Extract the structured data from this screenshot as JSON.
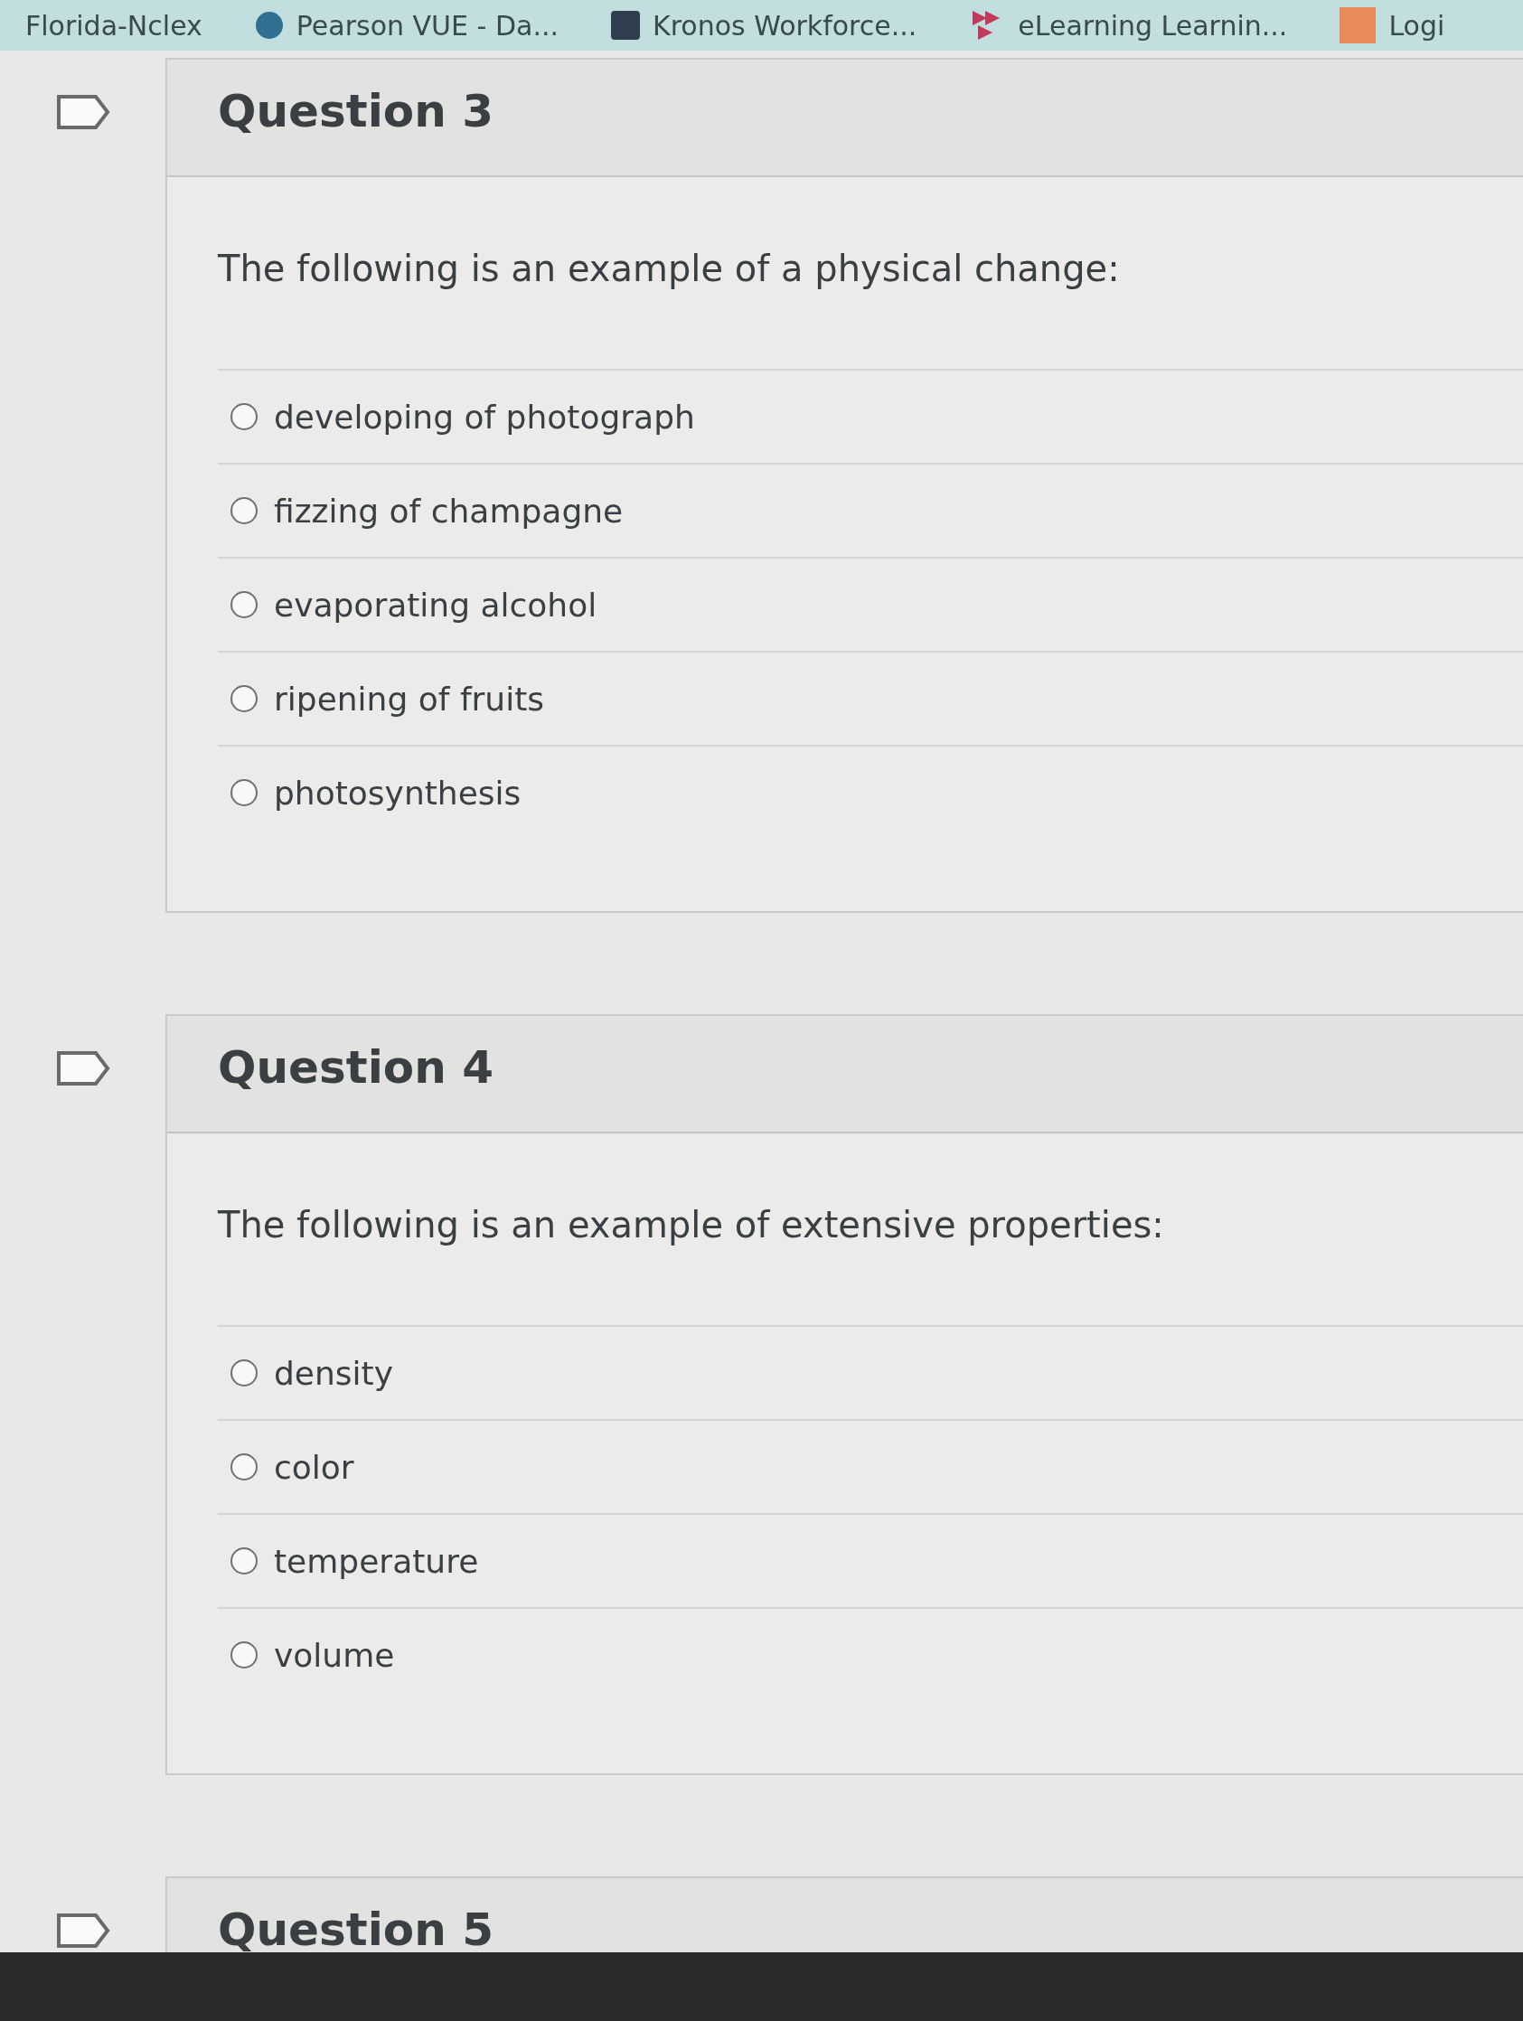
{
  "bookmarks": [
    {
      "label": "Florida-Nclex",
      "kind": "none"
    },
    {
      "label": "Pearson VUE - Da...",
      "kind": "circle"
    },
    {
      "label": "Kronos Workforce...",
      "kind": "square"
    },
    {
      "label": "eLearning Learnin...",
      "kind": "play"
    },
    {
      "label": "Logi",
      "kind": "orange"
    }
  ],
  "questions": [
    {
      "title": "Question 3",
      "prompt": "The following is an example of a physical change:",
      "options": [
        {
          "label": "developing of photograph",
          "selected": false
        },
        {
          "label": "fizzing of champagne",
          "selected": false
        },
        {
          "label": "evaporating alcohol",
          "selected": false
        },
        {
          "label": "ripening of fruits",
          "selected": false
        },
        {
          "label": "photosynthesis",
          "selected": false
        }
      ]
    },
    {
      "title": "Question 4",
      "prompt": "The following is an example of extensive properties:",
      "options": [
        {
          "label": "density",
          "selected": false
        },
        {
          "label": "color",
          "selected": false
        },
        {
          "label": "temperature",
          "selected": false
        },
        {
          "label": "volume",
          "selected": false
        }
      ]
    },
    {
      "title": "Question 5"
    }
  ]
}
